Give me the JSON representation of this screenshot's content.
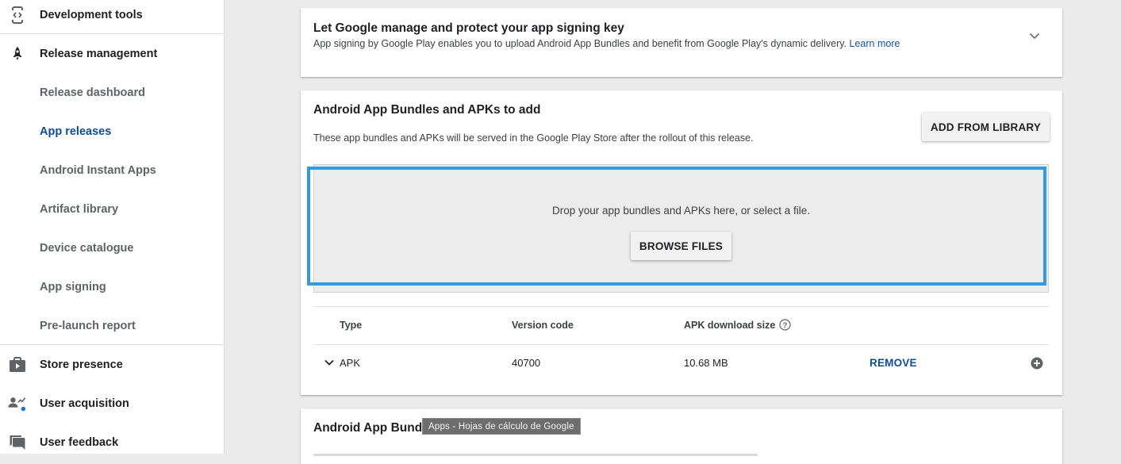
{
  "sidebar": {
    "items": [
      {
        "label": "Development tools",
        "icon": "code-brackets-icon"
      },
      {
        "label": "Release management",
        "icon": "rocket-icon"
      },
      {
        "label": "Release dashboard"
      },
      {
        "label": "App releases"
      },
      {
        "label": "Android Instant Apps"
      },
      {
        "label": "Artifact library"
      },
      {
        "label": "Device catalogue"
      },
      {
        "label": "App signing"
      },
      {
        "label": "Pre-launch report"
      },
      {
        "label": "Store presence",
        "icon": "shopping-bag-icon"
      },
      {
        "label": "User acquisition",
        "icon": "person-chart-icon"
      },
      {
        "label": "User feedback",
        "icon": "chat-bubble-icon"
      }
    ]
  },
  "signing_card": {
    "title": "Let Google manage and protect your app signing key",
    "description": "App signing by Google Play enables you to upload Android App Bundles and benefit from Google Play's dynamic delivery.",
    "learn_more": "Learn more"
  },
  "bundles_card": {
    "title": "Android App Bundles and APKs to add",
    "description": "These app bundles and APKs will be served in the Google Play Store after the rollout of this release.",
    "add_from_library": "ADD FROM LIBRARY",
    "dropzone_text": "Drop your app bundles and APKs here, or select a file.",
    "browse_files": "BROWSE FILES",
    "table": {
      "headers": {
        "type": "Type",
        "version_code": "Version code",
        "download_size": "APK download size"
      },
      "rows": [
        {
          "type": "APK",
          "version_code": "40700",
          "download_size": "10.68 MB",
          "action": "REMOVE"
        }
      ]
    }
  },
  "third_card": {
    "title": "Android App Bundle"
  },
  "tooltip": "Apps - Hojas de cálculo de Google",
  "colors": {
    "accent": "#0b4d9b",
    "highlight": "#2d9be5",
    "background": "#ebebeb"
  }
}
